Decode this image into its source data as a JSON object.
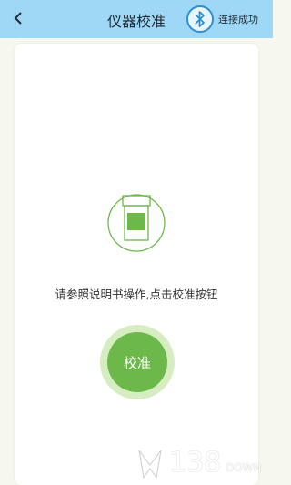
{
  "header": {
    "title": "仪器校准",
    "back_icon": "chevron-left-icon",
    "bluetooth_icon": "bluetooth-icon",
    "status": "连接成功"
  },
  "main": {
    "device_icon": "test-device-icon",
    "instruction": "请参照说明书操作,点击校准按钮",
    "calibrate_label": "校准"
  },
  "watermark": {
    "number": "138",
    "suffix": "DOWN"
  },
  "colors": {
    "header_bg": "#9fd8f6",
    "accent_green": "#6cb84a",
    "bluetooth_blue": "#2c8fd0"
  }
}
